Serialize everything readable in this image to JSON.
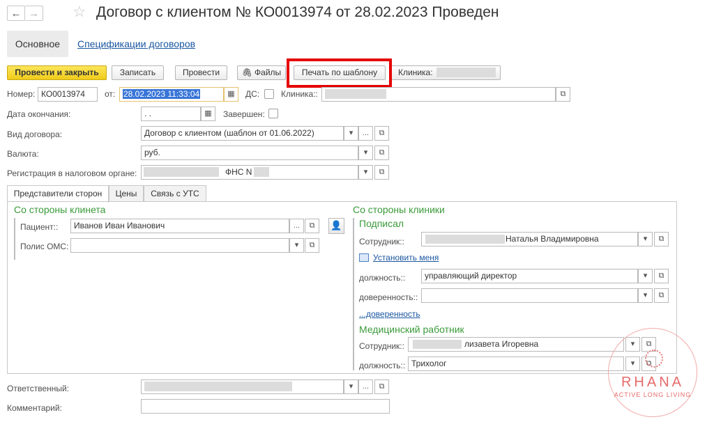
{
  "header": {
    "back_icon": "arrow-left-icon",
    "forward_icon": "arrow-right-icon",
    "title": "Договор с клиентом № КО0013974 от 28.02.2023 Проведен"
  },
  "nav_tabs": {
    "main": "Основное",
    "specs": "Спецификации договоров"
  },
  "toolbar": {
    "post_close": "Провести и закрыть",
    "save": "Записать",
    "post": "Провести",
    "files": "Файлы",
    "print_template": "Печать по шаблону",
    "clinic_label": "Клиника:"
  },
  "form": {
    "number_label": "Номер:",
    "number_value": "КО0013974",
    "date_label": "от:",
    "date_value": "28.02.2023 11:33:04",
    "ds_label": "ДС:",
    "clinic_label": "Клиника::",
    "end_date_label": "Дата окончания:",
    "end_date_value": " .  .",
    "completed_label": "Завершен:",
    "contract_type_label": "Вид договора:",
    "contract_type_value": "Договор с клиентом (шаблон от 01.06.2022)",
    "currency_label": "Валюта:",
    "currency_value": "руб.",
    "tax_reg_label": "Регистрация в налоговом органе:",
    "tax_reg_value": "ФНС N",
    "responsible_label": "Ответственный:",
    "comment_label": "Комментарий:"
  },
  "inner_tabs": [
    "Представители сторон",
    "Цены",
    "Связь с УТС"
  ],
  "client_side": {
    "heading": "Со стороны клинета",
    "patient_label": "Пациент::",
    "patient_value": "Иванов Иван Иванович",
    "oms_label": "Полис ОМС:"
  },
  "clinic_side": {
    "heading": "Со стороны клиники",
    "signed_heading": "Подписал",
    "employee_label": "Сотрудник::",
    "employee_value": "Наталья Владимировна",
    "set_me_link": "Установить меня",
    "position_label": "должность::",
    "position_value": "управляющий директор",
    "power_label": "доверенность::",
    "power_link": "...доверенность",
    "medical_heading": "Медицинский работник",
    "med_employee_label": "Сотрудник::",
    "med_employee_value": "лизавета Игоревна",
    "med_position_label": "должность::",
    "med_position_value": "Трихолог"
  },
  "watermark": {
    "brand": "RHANA",
    "tagline": "ACTIVE LONG LIVING"
  }
}
